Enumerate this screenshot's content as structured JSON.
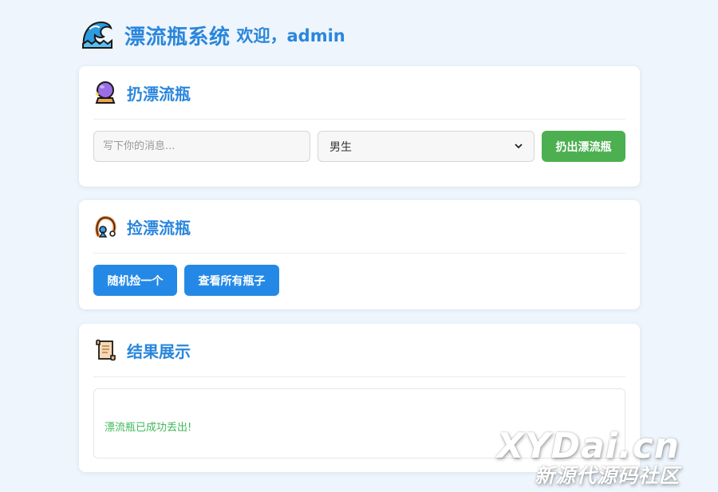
{
  "header": {
    "logo_icon": "wave-icon",
    "title": "漂流瓶系统",
    "welcome": "欢迎，admin"
  },
  "throw_section": {
    "icon": "crystal-ball-icon",
    "title": "扔漂流瓶",
    "message_placeholder": "写下你的消息...",
    "gender_selected": "男生",
    "throw_button": "扔出漂流瓶"
  },
  "pick_section": {
    "icon": "fishing-hook-icon",
    "title": "捡漂流瓶",
    "random_button": "随机捡一个",
    "view_all_button": "查看所有瓶子"
  },
  "result_section": {
    "icon": "scroll-icon",
    "title": "结果展示",
    "message": "漂流瓶已成功丢出!"
  },
  "watermark": {
    "main": "XYDai.cn",
    "sub": "新源代源码社区"
  },
  "colors": {
    "accent": "#2a86dc",
    "throw_button": "#4caf50",
    "pick_button": "#2489e6",
    "success_text": "#3fb95a",
    "page_background": "#eef5fc"
  }
}
